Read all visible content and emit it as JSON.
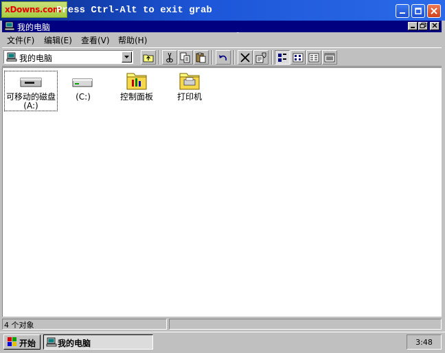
{
  "host_window": {
    "logo_text": "xDowns.com",
    "title": "Press Ctrl-Alt to exit grab",
    "buttons": [
      "minimize-icon",
      "maximize-icon",
      "close-icon"
    ]
  },
  "window": {
    "title": "我的电脑",
    "icon": "my-computer-icon"
  },
  "menu": [
    {
      "label": "文件(F)"
    },
    {
      "label": "编辑(E)"
    },
    {
      "label": "查看(V)"
    },
    {
      "label": "帮助(H)"
    }
  ],
  "toolbar": {
    "address_value": "我的电脑",
    "buttons": [
      "up-folder-icon",
      "cut-icon",
      "copy-icon",
      "paste-icon",
      "undo-icon",
      "delete-icon",
      "properties-icon",
      "large-icons-view-icon",
      "small-icons-view-icon",
      "list-view-icon",
      "details-view-icon"
    ]
  },
  "items": [
    {
      "label": "可移动的磁盘",
      "sublabel": "(A:)",
      "icon": "floppy-drive-icon",
      "selected": true
    },
    {
      "label": "(C:)",
      "icon": "hard-drive-icon",
      "selected": false
    },
    {
      "label": "控制面板",
      "icon": "control-panel-folder-icon",
      "selected": false
    },
    {
      "label": "打印机",
      "icon": "printers-folder-icon",
      "selected": false
    }
  ],
  "status": {
    "object_count": "4 个对象"
  },
  "taskbar": {
    "start_label": "开始",
    "task_label": "我的电脑",
    "clock": "3:48"
  },
  "colors": {
    "titlebar": "#000080",
    "face": "#c0c0c0",
    "host_titlebar": "#1d56d8"
  }
}
